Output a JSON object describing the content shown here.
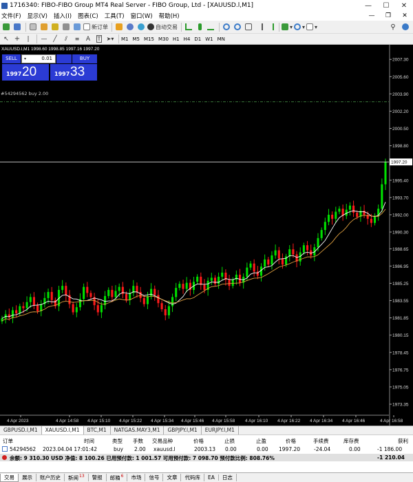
{
  "window": {
    "title": "1716340: FIBO-FIBO Group MT4 Real Server - FIBO Group, Ltd - [XAUUSD.l,M1]",
    "minimize": "—",
    "maximize": "☐",
    "close": "✕"
  },
  "menu": {
    "items": [
      "文件(F)",
      "显示(V)",
      "插入(I)",
      "图表(C)",
      "工具(T)",
      "窗口(W)",
      "帮助(H)"
    ],
    "right": [
      "—",
      "❐",
      "✕"
    ]
  },
  "toolbar": {
    "new_order": "新订单",
    "auto_trade": "自动交易",
    "timeframes": [
      "M1",
      "M5",
      "M15",
      "M30",
      "H1",
      "H4",
      "D1",
      "W1",
      "MN"
    ]
  },
  "chart": {
    "symbol_info": "XAUUSD.l,M1  1998.60 1998.85 1997.16 1997.20",
    "order_line_label": "#54294562 buy 2.00",
    "current_price": "1997.20",
    "colors": {
      "bull": "#00e000",
      "bear": "#ff1a1a",
      "ma_fast": "#ffffff",
      "ma_slow": "#e0a040",
      "price_line": "#d8d8d8",
      "order_line": "#3a7a3a"
    }
  },
  "one_click": {
    "sell_label": "SELL",
    "buy_label": "BUY",
    "lot": "0.01",
    "sell_base": "1997",
    "sell_big": "20",
    "buy_base": "1997",
    "buy_big": "33"
  },
  "chart_data": {
    "type": "candlestick",
    "y_ticks": [
      "2007.30",
      "2005.60",
      "2003.90",
      "2002.20",
      "2000.50",
      "1998.80",
      "1997.10",
      "1995.40",
      "1993.70",
      "1992.00",
      "1990.30",
      "1988.65",
      "1986.95",
      "1985.25",
      "1983.55",
      "1981.85",
      "1980.15",
      "1978.45",
      "1976.75",
      "1975.05",
      "1973.35"
    ],
    "ylim": [
      1972.4,
      2008.4
    ],
    "x_ticks": [
      "4 Apr 2023",
      "4 Apr 14:58",
      "4 Apr 15:10",
      "4 Apr 15:22",
      "4 Apr 15:34",
      "4 Apr 15:46",
      "4 Apr 15:58",
      "4 Apr 16:10",
      "4 Apr 16:22",
      "4 Apr 16:34",
      "4 Apr 16:46",
      "4 Apr 16:58"
    ],
    "last_price": 1997.2,
    "order_price": 2003.13,
    "closes": [
      1981.8,
      1982.2,
      1981.9,
      1982.6,
      1982.3,
      1983.0,
      1982.8,
      1983.4,
      1983.9,
      1983.1,
      1982.5,
      1983.2,
      1983.8,
      1984.4,
      1983.6,
      1983.0,
      1984.6,
      1985.0,
      1984.1,
      1983.2,
      1982.4,
      1982.9,
      1983.7,
      1984.9,
      1984.3,
      1983.9,
      1983.1,
      1982.4,
      1983.1,
      1984.0,
      1984.6,
      1983.9,
      1984.5,
      1984.9,
      1984.2,
      1983.6,
      1984.3,
      1985.0,
      1984.4,
      1983.8,
      1983.2,
      1984.0,
      1984.7,
      1984.1,
      1983.3,
      1982.7,
      1982.1,
      1983.0,
      1983.9,
      1984.8,
      1985.2,
      1984.7,
      1985.3,
      1984.6,
      1985.4,
      1985.9,
      1985.1,
      1984.6,
      1985.5,
      1985.8,
      1985.2,
      1985.9,
      1986.3,
      1985.6,
      1985.0,
      1985.6,
      1986.1,
      1985.3,
      1985.9,
      1986.8,
      1987.2,
      1986.4,
      1986.0,
      1986.9,
      1987.6,
      1987.1,
      1988.0,
      1988.5,
      1987.7,
      1987.1,
      1987.9,
      1988.6,
      1988.1,
      1987.4,
      1988.3,
      1989.0,
      1988.5,
      1988.0,
      1988.8,
      1989.7,
      1990.5,
      1991.3,
      1992.0,
      1991.6,
      1992.3,
      1992.6,
      1991.9,
      1992.5,
      1992.9,
      1992.2,
      1991.8,
      1992.4,
      1992.0,
      1991.6,
      1991.2,
      1991.9,
      1992.6,
      1995.0,
      1997.2
    ]
  },
  "chart_tabs": [
    "GBPUSD.l,M1",
    "XAUUSD.l,M1",
    "BTC,M1",
    "NATGAS.MAY3,M1",
    "GBPJPY.l,M1",
    "EURJPY.l,M1"
  ],
  "terminal": {
    "headers": [
      "订单",
      "时间",
      "类型",
      "手数",
      "交易品种",
      "价格",
      "止损",
      "止盈",
      "价格",
      "手续费",
      "库存费",
      "获利"
    ],
    "row": [
      "54294562",
      "2023.04.04 17:01:42",
      "buy",
      "2.00",
      "xauusd.l",
      "2003.13",
      "0.00",
      "0.00",
      "1997.20",
      "-24.04",
      "0.00",
      "-1 186.00"
    ],
    "balance": "余额: 9 310.30 USD  净值: 8 100.26  已用预付款: 1 001.57  可用预付款: 7 098.70  预付款比例: 808.76%",
    "balance_profit": "-1 210.04"
  },
  "bottom_tabs": [
    {
      "label": "交易",
      "badge": ""
    },
    {
      "label": "展示",
      "badge": ""
    },
    {
      "label": "账户历史",
      "badge": ""
    },
    {
      "label": "新闻",
      "badge": "13"
    },
    {
      "label": "警报",
      "badge": ""
    },
    {
      "label": "邮箱",
      "badge": "6"
    },
    {
      "label": "市场",
      "badge": ""
    },
    {
      "label": "信号",
      "badge": ""
    },
    {
      "label": "文章",
      "badge": ""
    },
    {
      "label": "代码库",
      "badge": ""
    },
    {
      "label": "EA",
      "badge": ""
    },
    {
      "label": "日志",
      "badge": ""
    }
  ]
}
